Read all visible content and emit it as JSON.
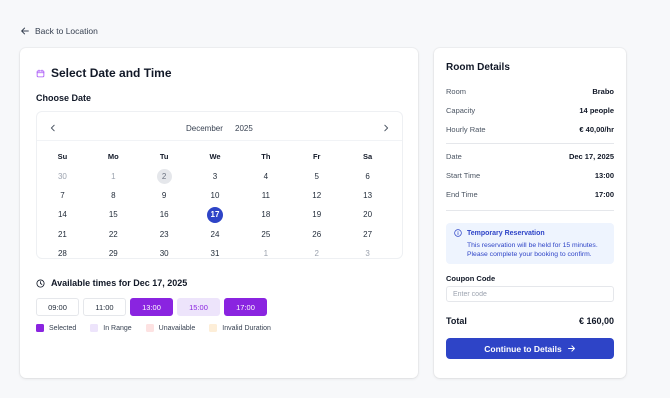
{
  "nav": {
    "back_label": "Back to Location"
  },
  "booking": {
    "title": "Select Date and Time",
    "choose_date_label": "Choose Date",
    "calendar": {
      "month": "December",
      "year": "2025",
      "weekdays": [
        "Su",
        "Mo",
        "Tu",
        "We",
        "Th",
        "Fr",
        "Sa"
      ],
      "weeks": [
        [
          "30",
          "1",
          "2",
          "3",
          "4",
          "5",
          "6"
        ],
        [
          "7",
          "8",
          "9",
          "10",
          "11",
          "12",
          "13"
        ],
        [
          "14",
          "15",
          "16",
          "17",
          "18",
          "19",
          "20"
        ],
        [
          "21",
          "22",
          "23",
          "24",
          "25",
          "26",
          "27"
        ],
        [
          "28",
          "29",
          "30",
          "31",
          "1",
          "2",
          "3"
        ]
      ]
    },
    "available_times_label": "Available times for Dec 17, 2025",
    "slots": [
      "09:00",
      "11:00",
      "13:00",
      "15:00",
      "17:00"
    ],
    "legend": [
      "Selected",
      "In Range",
      "Unavailable",
      "Invalid Duration"
    ],
    "colors": {
      "selected": "#8a24e0",
      "in_range": "#ede4fb",
      "unavailable": "#fde2e2",
      "invalid": "#fdeed8",
      "accent": "#2e44c7"
    }
  },
  "details": {
    "title": "Room Details",
    "room_label": "Room",
    "room_value": "Brabo",
    "capacity_label": "Capacity",
    "capacity_value": "14 people",
    "rate_label": "Hourly Rate",
    "rate_value": "€ 40,00/hr",
    "date_label": "Date",
    "date_value": "Dec 17, 2025",
    "start_label": "Start Time",
    "start_value": "13:00",
    "end_label": "End Time",
    "end_value": "17:00",
    "notice_title": "Temporary Reservation",
    "notice_line1": "This reservation will be held for 15 minutes.",
    "notice_line2": "Please complete your booking to confirm.",
    "coupon_label": "Coupon Code",
    "coupon_placeholder": "Enter code",
    "total_label": "Total",
    "total_value": "€ 160,00",
    "cta_label": "Continue to Details"
  }
}
